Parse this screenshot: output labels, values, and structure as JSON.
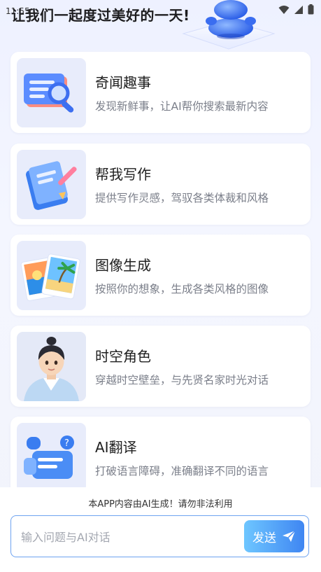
{
  "status_bar": {
    "time": "11:55"
  },
  "headline": "让我们一起度过美好的一天!",
  "cards": [
    {
      "title": "奇闻趣事",
      "desc": "发现新鲜事，让AI帮你搜索最新内容",
      "icon": "search-news-icon"
    },
    {
      "title": "帮我写作",
      "desc": "提供写作灵感，驾驭各类体裁和风格",
      "icon": "notebook-pen-icon"
    },
    {
      "title": "图像生成",
      "desc": "按照你的想象，生成各类风格的图像",
      "icon": "photo-gallery-icon"
    },
    {
      "title": "时空角色",
      "desc": "穿越时空壁垒，与先贤名家时光对话",
      "icon": "ancient-character-avatar"
    },
    {
      "title": "AI翻译",
      "desc": "打破语言障碍，准确翻译不同的语言",
      "icon": "translate-chat-icon"
    }
  ],
  "footer": {
    "notice": "本APP内容由AI生成！请勿非法利用",
    "input_placeholder": "输入问题与AI对话",
    "send_label": "发送"
  }
}
